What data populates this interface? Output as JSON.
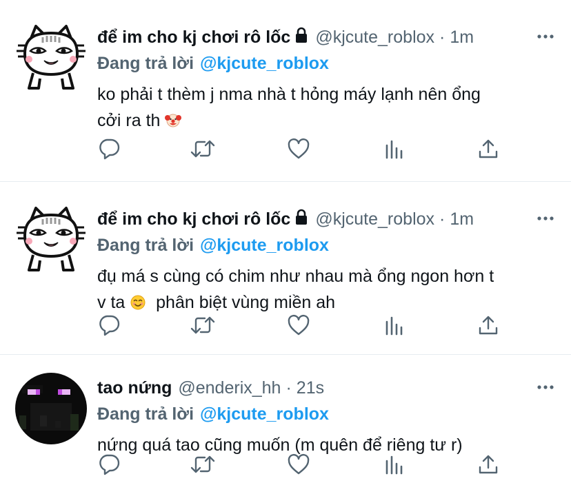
{
  "tweets": [
    {
      "name": "để im cho kj chơi rô lốc",
      "handle": "@kjcute_roblox",
      "separator": "·",
      "time": "1m",
      "reply_prefix": "Đang trả lời",
      "reply_to": "@kjcute_roblox",
      "text_line1": "ko phải t thèm j nma nhà t hỏng máy lạnh nên ổng",
      "text_line2": "cởi ra th",
      "emoji": "clown-face-emoji",
      "avatar": "white-cat-face-avatar",
      "locked": true
    },
    {
      "name": "để im cho kj chơi rô lốc",
      "handle": "@kjcute_roblox",
      "separator": "·",
      "time": "1m",
      "reply_prefix": "Đang trả lời",
      "reply_to": "@kjcute_roblox",
      "text_line1": "đụ má s cùng có chim như nhau mà ổng ngon hơn t",
      "text_line2a": "v ta",
      "text_line2b": "phân biệt vùng miền ah",
      "emoji": "smiling-face-emoji",
      "avatar": "white-cat-face-avatar",
      "locked": true
    },
    {
      "name": "tao nứng",
      "handle": "@enderix_hh",
      "separator": "·",
      "time": "21s",
      "reply_prefix": "Đang trả lời",
      "reply_to": "@kjcute_roblox",
      "text_line1": "nứng quá tao cũng muốn (m quên để riêng tư r)",
      "avatar": "enderman-avatar",
      "locked": false
    }
  ],
  "icons": [
    "lock-icon",
    "more-icon",
    "reply-icon",
    "retweet-icon",
    "like-icon",
    "stats-icon",
    "share-icon"
  ],
  "colors": {
    "text": "#0f1419",
    "secondary": "#536471",
    "accent": "#1d9bf0",
    "divider": "#e6ecf0"
  }
}
